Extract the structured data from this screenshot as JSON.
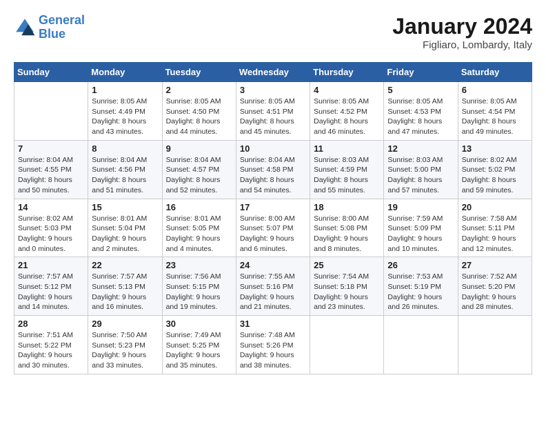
{
  "header": {
    "logo_line1": "General",
    "logo_line2": "Blue",
    "title": "January 2024",
    "subtitle": "Figliaro, Lombardy, Italy"
  },
  "weekdays": [
    "Sunday",
    "Monday",
    "Tuesday",
    "Wednesday",
    "Thursday",
    "Friday",
    "Saturday"
  ],
  "weeks": [
    [
      {
        "day": "",
        "info": ""
      },
      {
        "day": "1",
        "info": "Sunrise: 8:05 AM\nSunset: 4:49 PM\nDaylight: 8 hours\nand 43 minutes."
      },
      {
        "day": "2",
        "info": "Sunrise: 8:05 AM\nSunset: 4:50 PM\nDaylight: 8 hours\nand 44 minutes."
      },
      {
        "day": "3",
        "info": "Sunrise: 8:05 AM\nSunset: 4:51 PM\nDaylight: 8 hours\nand 45 minutes."
      },
      {
        "day": "4",
        "info": "Sunrise: 8:05 AM\nSunset: 4:52 PM\nDaylight: 8 hours\nand 46 minutes."
      },
      {
        "day": "5",
        "info": "Sunrise: 8:05 AM\nSunset: 4:53 PM\nDaylight: 8 hours\nand 47 minutes."
      },
      {
        "day": "6",
        "info": "Sunrise: 8:05 AM\nSunset: 4:54 PM\nDaylight: 8 hours\nand 49 minutes."
      }
    ],
    [
      {
        "day": "7",
        "info": "Sunrise: 8:04 AM\nSunset: 4:55 PM\nDaylight: 8 hours\nand 50 minutes."
      },
      {
        "day": "8",
        "info": "Sunrise: 8:04 AM\nSunset: 4:56 PM\nDaylight: 8 hours\nand 51 minutes."
      },
      {
        "day": "9",
        "info": "Sunrise: 8:04 AM\nSunset: 4:57 PM\nDaylight: 8 hours\nand 52 minutes."
      },
      {
        "day": "10",
        "info": "Sunrise: 8:04 AM\nSunset: 4:58 PM\nDaylight: 8 hours\nand 54 minutes."
      },
      {
        "day": "11",
        "info": "Sunrise: 8:03 AM\nSunset: 4:59 PM\nDaylight: 8 hours\nand 55 minutes."
      },
      {
        "day": "12",
        "info": "Sunrise: 8:03 AM\nSunset: 5:00 PM\nDaylight: 8 hours\nand 57 minutes."
      },
      {
        "day": "13",
        "info": "Sunrise: 8:02 AM\nSunset: 5:02 PM\nDaylight: 8 hours\nand 59 minutes."
      }
    ],
    [
      {
        "day": "14",
        "info": "Sunrise: 8:02 AM\nSunset: 5:03 PM\nDaylight: 9 hours\nand 0 minutes."
      },
      {
        "day": "15",
        "info": "Sunrise: 8:01 AM\nSunset: 5:04 PM\nDaylight: 9 hours\nand 2 minutes."
      },
      {
        "day": "16",
        "info": "Sunrise: 8:01 AM\nSunset: 5:05 PM\nDaylight: 9 hours\nand 4 minutes."
      },
      {
        "day": "17",
        "info": "Sunrise: 8:00 AM\nSunset: 5:07 PM\nDaylight: 9 hours\nand 6 minutes."
      },
      {
        "day": "18",
        "info": "Sunrise: 8:00 AM\nSunset: 5:08 PM\nDaylight: 9 hours\nand 8 minutes."
      },
      {
        "day": "19",
        "info": "Sunrise: 7:59 AM\nSunset: 5:09 PM\nDaylight: 9 hours\nand 10 minutes."
      },
      {
        "day": "20",
        "info": "Sunrise: 7:58 AM\nSunset: 5:11 PM\nDaylight: 9 hours\nand 12 minutes."
      }
    ],
    [
      {
        "day": "21",
        "info": "Sunrise: 7:57 AM\nSunset: 5:12 PM\nDaylight: 9 hours\nand 14 minutes."
      },
      {
        "day": "22",
        "info": "Sunrise: 7:57 AM\nSunset: 5:13 PM\nDaylight: 9 hours\nand 16 minutes."
      },
      {
        "day": "23",
        "info": "Sunrise: 7:56 AM\nSunset: 5:15 PM\nDaylight: 9 hours\nand 19 minutes."
      },
      {
        "day": "24",
        "info": "Sunrise: 7:55 AM\nSunset: 5:16 PM\nDaylight: 9 hours\nand 21 minutes."
      },
      {
        "day": "25",
        "info": "Sunrise: 7:54 AM\nSunset: 5:18 PM\nDaylight: 9 hours\nand 23 minutes."
      },
      {
        "day": "26",
        "info": "Sunrise: 7:53 AM\nSunset: 5:19 PM\nDaylight: 9 hours\nand 26 minutes."
      },
      {
        "day": "27",
        "info": "Sunrise: 7:52 AM\nSunset: 5:20 PM\nDaylight: 9 hours\nand 28 minutes."
      }
    ],
    [
      {
        "day": "28",
        "info": "Sunrise: 7:51 AM\nSunset: 5:22 PM\nDaylight: 9 hours\nand 30 minutes."
      },
      {
        "day": "29",
        "info": "Sunrise: 7:50 AM\nSunset: 5:23 PM\nDaylight: 9 hours\nand 33 minutes."
      },
      {
        "day": "30",
        "info": "Sunrise: 7:49 AM\nSunset: 5:25 PM\nDaylight: 9 hours\nand 35 minutes."
      },
      {
        "day": "31",
        "info": "Sunrise: 7:48 AM\nSunset: 5:26 PM\nDaylight: 9 hours\nand 38 minutes."
      },
      {
        "day": "",
        "info": ""
      },
      {
        "day": "",
        "info": ""
      },
      {
        "day": "",
        "info": ""
      }
    ]
  ]
}
